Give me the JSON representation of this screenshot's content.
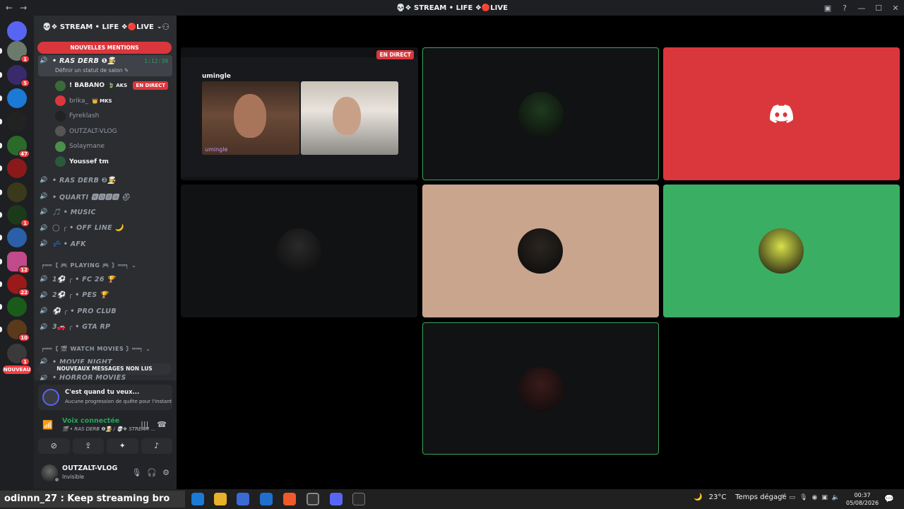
{
  "window": {
    "title": "💀❖ STREAM • LIFE ❖🔴LIVE",
    "back_icon": "←",
    "forward_icon": "→"
  },
  "servers": [
    {
      "name": "home",
      "badge": ""
    },
    {
      "name": "server-1",
      "badge": "1"
    },
    {
      "name": "server-2",
      "badge": "5"
    },
    {
      "name": "server-3",
      "badge": ""
    },
    {
      "name": "server-4",
      "badge": ""
    },
    {
      "name": "server-5",
      "badge": "47"
    },
    {
      "name": "server-6",
      "badge": ""
    },
    {
      "name": "server-7",
      "badge": ""
    },
    {
      "name": "server-8",
      "badge": "1"
    },
    {
      "name": "server-9",
      "badge": ""
    },
    {
      "name": "server-10",
      "badge": "12"
    },
    {
      "name": "server-11",
      "badge": "22"
    },
    {
      "name": "server-12",
      "badge": ""
    },
    {
      "name": "server-13",
      "badge": "10"
    },
    {
      "name": "server-14",
      "badge": "1"
    }
  ],
  "rail": {
    "new_label": "NOUVEAU"
  },
  "guild": {
    "name": "💀❖ STREAM • LIFE ❖🔴LIVE",
    "new_mentions": "NOUVELLES MENTIONS",
    "new_unread": "NOUVEAUX MESSAGES NON LUS"
  },
  "active_channel": {
    "name": "• RAS DERB ❶👨‍🍳",
    "timer": "1:12:39",
    "status": "Définir un statut de salon ✎"
  },
  "members": [
    {
      "name": "! BABANO",
      "tag": "🍃 AKS",
      "live": "EN DIRECT",
      "white": true,
      "color": "#3a6b3a"
    },
    {
      "name": "brika_",
      "tag": "👑 MKS",
      "live": "",
      "white": false,
      "color": "#da373c"
    },
    {
      "name": "Fyreklash",
      "tag": "",
      "live": "",
      "white": false,
      "color": "#222"
    },
    {
      "name": "OUTZALT-VLOG",
      "tag": "",
      "live": "",
      "white": false,
      "color": "#555"
    },
    {
      "name": "Solaymane",
      "tag": "",
      "live": "",
      "white": false,
      "color": "#4a8f4a"
    },
    {
      "name": "Youssef tm",
      "tag": "",
      "live": "",
      "white": true,
      "color": "#2a5a3a"
    }
  ],
  "channels": [
    {
      "name": "• RAS DERB ❷👨‍🍳"
    },
    {
      "name": "• QUARTI 🅺🅾🅱🅰 ⛑"
    },
    {
      "name": "🎵 • MUSIC"
    },
    {
      "name": "◯ ╭ • OFF LINE 🌙"
    },
    {
      "name": "💤 • AFK"
    }
  ],
  "categories": {
    "playing": "╒══〘 🎮 PLAYING 🎮 〙══╕ ⌄",
    "movies": "╒══〘 🎬 WATCH MOVIES 〙══╕ ⌄"
  },
  "playing_channels": [
    {
      "name": "1⚽ ╭ • FC 26 🏆"
    },
    {
      "name": "2⚽ ╭ • PES 🏆"
    },
    {
      "name": "⚽ ╭ • PRO CLUB"
    },
    {
      "name": "3🚗 ╭ • GTA RP"
    }
  ],
  "movie_channels": [
    {
      "name": "• MOVIE NIGHT"
    },
    {
      "name": "• HORROR MOVIES"
    }
  ],
  "quest": {
    "title": "C'est quand tu veux...",
    "subtitle": "Aucune progression de quête pour l'instant"
  },
  "voice": {
    "status": "Voix connectée",
    "location": "🎬 • RAS DERB ❶👨‍🍳 / 💀❖ STREAM ..."
  },
  "user": {
    "name": "OUTZALT-VLOG",
    "status": "Invisible"
  },
  "stream": {
    "live_badge": "EN DIRECT",
    "app_name": "umingle",
    "cam_label": "umingle"
  },
  "tiles": [
    {
      "name": "babano-tile",
      "bg": "#111214",
      "speaking": true,
      "avatar_color": "#1f3a1f"
    },
    {
      "name": "discord-tile",
      "bg": "#da373c",
      "speaking": false,
      "avatar_color": ""
    },
    {
      "name": "fyreklash-tile",
      "bg": "#111214",
      "speaking": false,
      "avatar_color": "#2a2a2a"
    },
    {
      "name": "outzalt-tile",
      "bg": "#c9a58d",
      "speaking": false,
      "avatar_color": "#2a2520"
    },
    {
      "name": "solaymane-tile",
      "bg": "#3aaf63",
      "speaking": false,
      "avatar_color": "#d8e04a"
    },
    {
      "name": "youssef-tile",
      "bg": "#111214",
      "speaking": true,
      "avatar_color": "#3a1a1a"
    }
  ],
  "overlay": {
    "text": "odinnn_27 : Keep streaming bro"
  },
  "taskbar": {
    "temperature": "23°C",
    "weather": "Temps dégagé",
    "time": "00:37",
    "date": "05/08/2026"
  }
}
